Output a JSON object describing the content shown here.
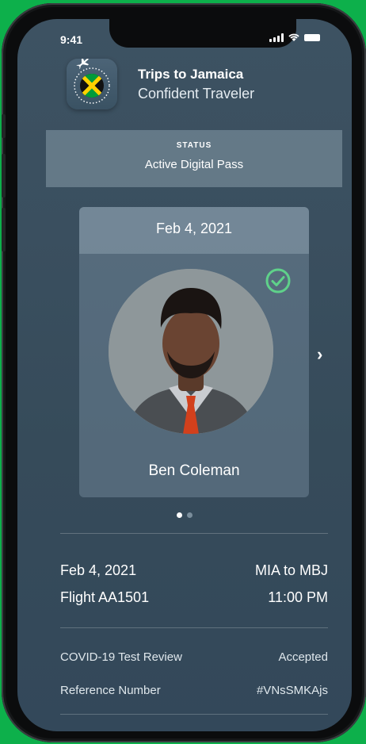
{
  "status_bar": {
    "time": "9:41"
  },
  "app": {
    "title": "Trips to Jamaica",
    "subtitle": "Confident Traveler"
  },
  "status": {
    "label": "STATUS",
    "value": "Active Digital Pass"
  },
  "pass_card": {
    "date": "Feb 4, 2021",
    "name": "Ben Coleman",
    "verified_icon": "check-circle-icon",
    "page": 1,
    "page_count": 2
  },
  "flight": {
    "date": "Feb 4, 2021",
    "route": "MIA to MBJ",
    "flight_number": "Flight AA1501",
    "time": "11:00 PM"
  },
  "details": [
    {
      "label": "COVID-19 Test Review",
      "value": "Accepted"
    },
    {
      "label": "Reference Number",
      "value": "#VNsSMKAjs"
    }
  ],
  "colors": {
    "background": "#0db04b",
    "accent_check": "#5fd18a",
    "flag_green": "#009b3a",
    "flag_yellow": "#fed100"
  }
}
